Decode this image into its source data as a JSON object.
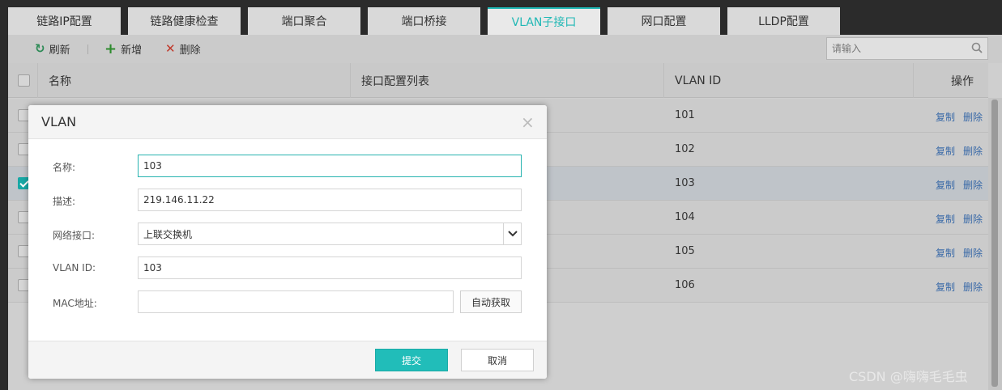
{
  "tabs": [
    {
      "label": "链路IP配置",
      "active": false
    },
    {
      "label": "链路健康检查",
      "active": false
    },
    {
      "label": "端口聚合",
      "active": false
    },
    {
      "label": "端口桥接",
      "active": false
    },
    {
      "label": "VLAN子接口",
      "active": true
    },
    {
      "label": "网口配置",
      "active": false
    },
    {
      "label": "LLDP配置",
      "active": false
    }
  ],
  "toolbar": {
    "refresh_label": "刷新",
    "add_label": "新增",
    "delete_label": "删除",
    "search_placeholder": "请输入"
  },
  "table": {
    "headers": {
      "name": "名称",
      "interfaces": "接口配置列表",
      "vlan_id": "VLAN ID",
      "ops": "操作"
    },
    "rows": [
      {
        "vlan_id": "101",
        "selected": false,
        "copy": "复制",
        "delete": "删除"
      },
      {
        "vlan_id": "102",
        "selected": false,
        "copy": "复制",
        "delete": "删除"
      },
      {
        "vlan_id": "103",
        "selected": true,
        "copy": "复制",
        "delete": "删除"
      },
      {
        "vlan_id": "104",
        "selected": false,
        "copy": "复制",
        "delete": "删除"
      },
      {
        "vlan_id": "105",
        "selected": false,
        "copy": "复制",
        "delete": "删除"
      },
      {
        "vlan_id": "106",
        "selected": false,
        "copy": "复制",
        "delete": "删除"
      }
    ]
  },
  "modal": {
    "title": "VLAN",
    "close": "×",
    "fields": {
      "name": {
        "label": "名称:",
        "value": "103"
      },
      "description": {
        "label": "描述:",
        "value": "219.146.11.22"
      },
      "interface": {
        "label": "网络接口:",
        "value": "上联交换机"
      },
      "vlan_id": {
        "label": "VLAN ID:",
        "value": "103"
      },
      "mac": {
        "label": "MAC地址:",
        "value": ""
      }
    },
    "auto_button": "自动获取",
    "submit": "提交",
    "cancel": "取消"
  },
  "watermark": "CSDN @嗨嗨毛毛虫",
  "colors": {
    "accent": "#21bdb9",
    "link": "#3a6aa8",
    "refresh": "#2e8b57",
    "add": "#2e8b2e",
    "delete": "#c0392b"
  }
}
